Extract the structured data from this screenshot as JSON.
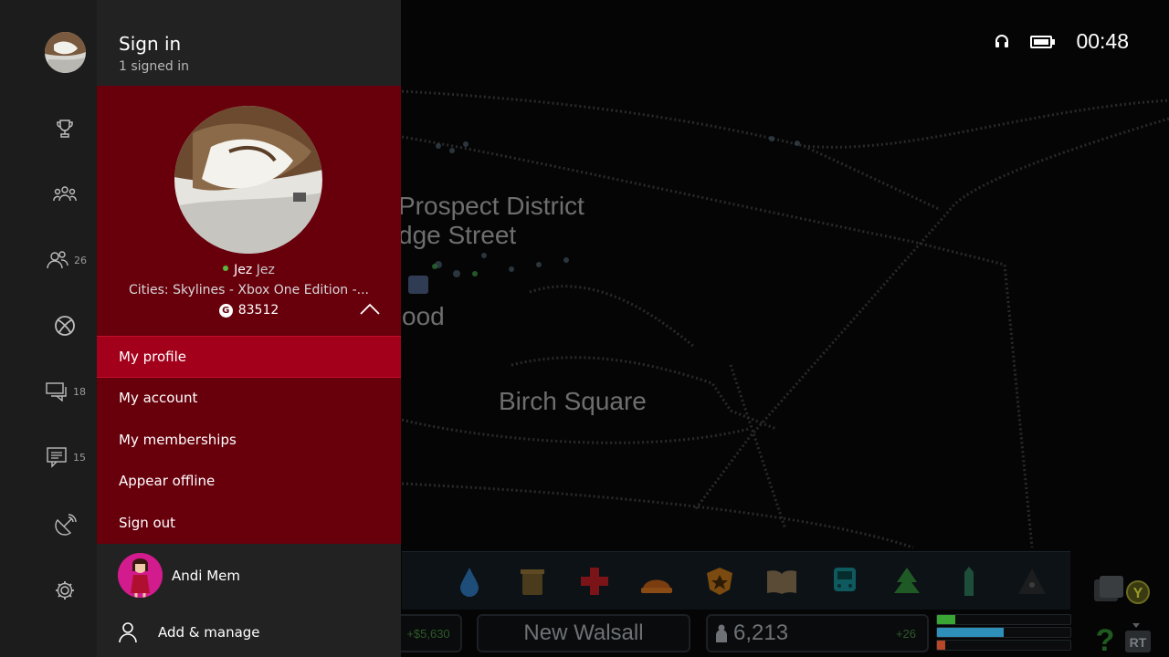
{
  "status": {
    "time": "00:48"
  },
  "game": {
    "districts": [
      "Prospect District",
      "dge Street",
      "ood",
      "Birch Square"
    ],
    "money": "+$5,630",
    "city_name": "New Walsall",
    "population": "6,213",
    "population_delta": "+26",
    "meters": [
      0.14,
      0.5,
      0.06
    ],
    "meter_colors": [
      "#3aa535",
      "#2e8fb8",
      "#b8472a"
    ]
  },
  "rail": {
    "friends_count": "26",
    "parties_count": "18",
    "messages_count": "15"
  },
  "guide": {
    "title": "Sign in",
    "subtitle": "1 signed in",
    "profile": {
      "gamertag": "Jez",
      "real_name": "Jez",
      "playing": "Cities: Skylines - Xbox One Edition -...",
      "gamerscore": "83512",
      "gamerscore_badge": "G"
    },
    "menu": [
      {
        "label": "My profile",
        "selected": true
      },
      {
        "label": "My account"
      },
      {
        "label": "My memberships"
      },
      {
        "label": "Appear offline"
      },
      {
        "label": "Sign out"
      }
    ],
    "other_user": "Andi Mem",
    "add_manage": "Add & manage"
  },
  "colors": {
    "accent": "#68000c",
    "selected": "#a3001b",
    "presence": "#5db840"
  }
}
